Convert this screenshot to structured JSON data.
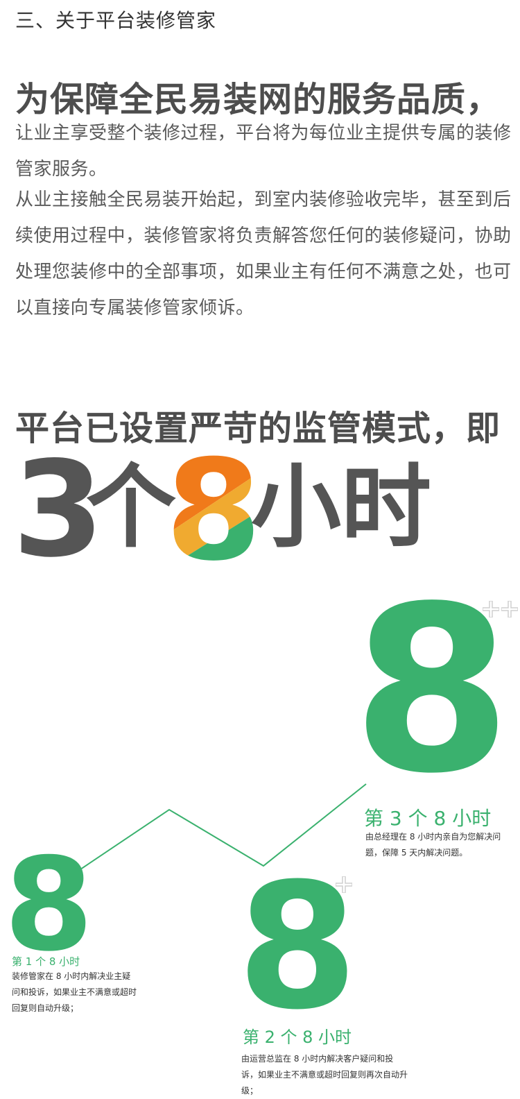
{
  "section": {
    "title": "三、关于平台装修管家"
  },
  "intro": {
    "headline": "为保障全民易装网的服务品质，",
    "paragraph1": "让业主享受整个装修过程，平台将为每位业主提供专属的装修管家服务。",
    "paragraph2": "从业主接触全民易装开始起，到室内装修验收完毕，甚至到后续使用过程中，装修管家将负责解答您任何的装修疑问，协助处理您装修中的全部事项，如果业主有任何不满意之处，也可以直接向专属装修管家倾诉。"
  },
  "supervision": {
    "headline": "平台已设置严苛的监管模式，即",
    "big_number": "3",
    "big_measure": "个",
    "big_eight": "8",
    "big_unit": "小时",
    "eight_colors": [
      "#f07a1a",
      "#f0aa30",
      "#3ab16e"
    ]
  },
  "tiers": [
    {
      "eight": "8",
      "label": "第 1 个 8 小时",
      "description": "装修管家在 8 小时内解决业主疑问和投诉，如果业主不满意或超时回复则自动升级；"
    },
    {
      "eight": "8",
      "label": "第 2 个 8 小时",
      "description": "由运营总监在 8 小时内解决客户疑问和投诉，如果业主不满意或超时回复则再次自动升级；"
    },
    {
      "eight": "8",
      "label": "第 3 个 8 小时",
      "description": "由总经理在 8 小时内亲自为您解决问题，保障 5 天内解决问题。"
    }
  ],
  "colors": {
    "accent_green": "#3ab16e",
    "heading_gray": "#4d4d4d",
    "body_gray": "#5a5a5a"
  },
  "icons": [
    "plus-icon"
  ]
}
